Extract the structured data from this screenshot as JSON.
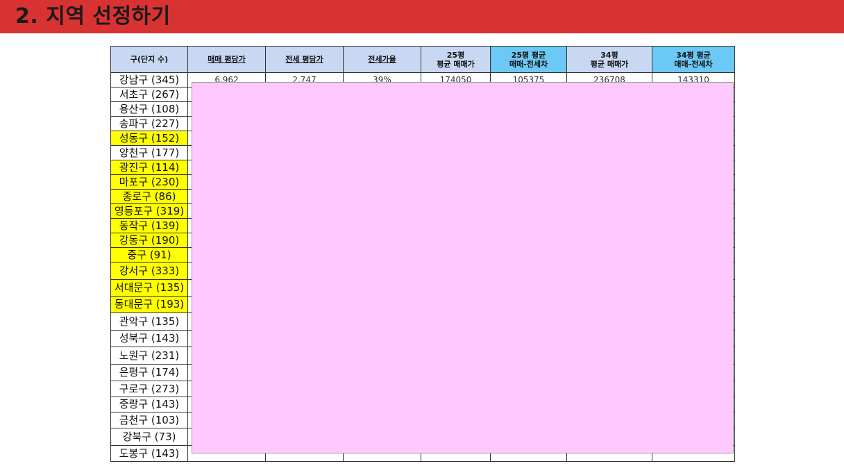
{
  "header": {
    "title": "2. 지역 선정하기",
    "bg_color": "#d93232"
  },
  "table": {
    "columns": [
      {
        "l1": "구(단지 수)",
        "l2": "",
        "style": "plain"
      },
      {
        "l1": "매매 평당가",
        "l2": "",
        "style": "ul"
      },
      {
        "l1": "전세 평당가",
        "l2": "",
        "style": "ul"
      },
      {
        "l1": "전세가율",
        "l2": "",
        "style": "ul"
      },
      {
        "l1": "25평",
        "l2": "평균 매매가",
        "style": "plain"
      },
      {
        "l1": "25평 평균",
        "l2": "매매-전세차",
        "style": "blue"
      },
      {
        "l1": "34평",
        "l2": "평균 매매가",
        "style": "plain"
      },
      {
        "l1": "34평 평균",
        "l2": "매매-전세차",
        "style": "blue"
      }
    ],
    "first_row_values": [
      "6,962",
      "2,747",
      "39%",
      "174050",
      "105375",
      "236708",
      "143310"
    ],
    "rows": [
      {
        "name": "강남구 (345)",
        "highlight": false
      },
      {
        "name": "서초구 (267)",
        "highlight": false
      },
      {
        "name": "용산구 (108)",
        "highlight": false
      },
      {
        "name": "송파구 (227)",
        "highlight": false
      },
      {
        "name": "성동구 (152)",
        "highlight": true
      },
      {
        "name": "양천구 (177)",
        "highlight": false
      },
      {
        "name": "광진구 (114)",
        "highlight": true
      },
      {
        "name": "마포구 (230)",
        "highlight": true
      },
      {
        "name": "종로구 (86)",
        "highlight": true
      },
      {
        "name": "영등포구 (319)",
        "highlight": true
      },
      {
        "name": "동작구 (139)",
        "highlight": true
      },
      {
        "name": "강동구 (190)",
        "highlight": true
      },
      {
        "name": "중구 (91)",
        "highlight": true
      },
      {
        "name": "강서구 (333)",
        "highlight": true
      },
      {
        "name": "서대문구 (135)",
        "highlight": true
      },
      {
        "name": "동대문구 (193)",
        "highlight": true
      },
      {
        "name": "관악구 (135)",
        "highlight": false
      },
      {
        "name": "성북구 (143)",
        "highlight": false
      },
      {
        "name": "노원구 (231)",
        "highlight": false
      },
      {
        "name": "은평구 (174)",
        "highlight": false
      },
      {
        "name": "구로구 (273)",
        "highlight": false
      },
      {
        "name": "중랑구 (143)",
        "highlight": false
      },
      {
        "name": "금천구 (103)",
        "highlight": false
      },
      {
        "name": "강북구 (73)",
        "highlight": false
      },
      {
        "name": "도봉구 (143)",
        "highlight": false
      }
    ]
  },
  "colors": {
    "header_cell": "#c9d8f2",
    "header_cell_accent": "#6cc8f4",
    "highlight": "#ffff00",
    "redaction_overlay": "#ffc8ff"
  }
}
